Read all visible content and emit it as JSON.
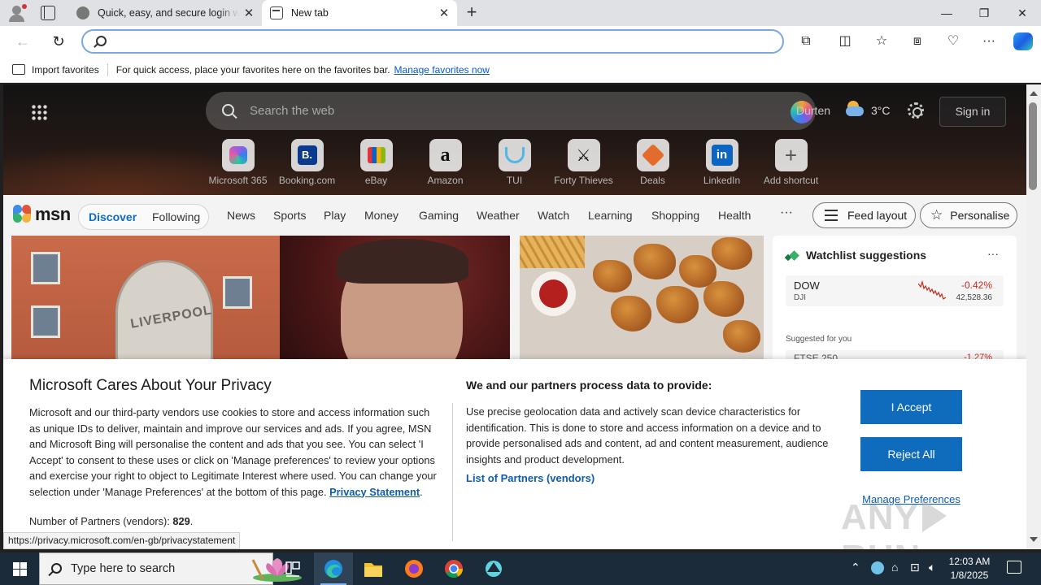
{
  "browser": {
    "tabs": [
      {
        "title": "Quick, easy, and secure login wit",
        "active": false
      },
      {
        "title": "New tab",
        "active": true
      }
    ],
    "address_placeholder": "",
    "window_controls": {
      "minimize": "—",
      "restore": "❐",
      "close": "✕"
    }
  },
  "favorites_bar": {
    "import_label": "Import favorites",
    "message": "For quick access, place your favorites here on the favorites bar.",
    "manage_link": "Manage favorites now"
  },
  "msn": {
    "search_placeholder": "Search the web",
    "location": "Durten",
    "temperature": "3°C",
    "sign_in": "Sign in",
    "shortcuts": [
      {
        "label": "Microsoft 365",
        "icon": "microsoft-365-icon"
      },
      {
        "label": "Booking.com",
        "icon": "booking-icon",
        "glyph": "B."
      },
      {
        "label": "eBay",
        "icon": "ebay-icon"
      },
      {
        "label": "Amazon",
        "icon": "amazon-icon",
        "glyph": "a"
      },
      {
        "label": "TUI",
        "icon": "tui-icon"
      },
      {
        "label": "Forty Thieves",
        "icon": "forty-thieves-icon",
        "glyph": "⚔"
      },
      {
        "label": "Deals",
        "icon": "deals-icon"
      },
      {
        "label": "LinkedIn",
        "icon": "linkedin-icon",
        "glyph": "in"
      },
      {
        "label": "Add shortcut",
        "icon": "plus-icon",
        "glyph": "+"
      }
    ],
    "logo_text": "msn",
    "feed_toggle": {
      "discover": "Discover",
      "following": "Following"
    },
    "nav": [
      "News",
      "Sports",
      "Play",
      "Money",
      "Gaming",
      "Weather",
      "Watch",
      "Learning",
      "Shopping",
      "Health"
    ],
    "more": "···",
    "feed_layout": "Feed layout",
    "personalise": "Personalise",
    "hero_crest_text": "LIVERPOOL",
    "watchlist": {
      "title": "Watchlist suggestions",
      "more": "···",
      "rows": [
        {
          "symbol": "DOW",
          "exchange": "DJI",
          "change": "-0.42%",
          "price": "42,528.36"
        }
      ],
      "suggested_label": "Suggested for you",
      "suggested": [
        {
          "symbol": "FTSE 250",
          "change": "-1.27%"
        }
      ]
    }
  },
  "privacy": {
    "title": "Microsoft Cares About Your Privacy",
    "body": "Microsoft and our third-party vendors use cookies to store and access information such as unique IDs to deliver, maintain and improve our services and ads. If you agree, MSN and Microsoft Bing will personalise the content and ads that you see. You can select 'I Accept' to consent to these uses or click on 'Manage preferences' to review your options and exercise your right to object to Legitimate Interest where used.  You can change your selection under 'Manage Preferences' at the bottom of this page.",
    "privacy_link": "Privacy Statement",
    "partners_count_label": "Number of Partners (vendors):",
    "partners_count": "829",
    "heading2": "We and our partners process data to provide:",
    "body2": "Use precise geolocation data and actively scan device characteristics for identification. This is done to store and access information on a device and to provide personalised ads and content, ad and content measurement, audience insights and product development.",
    "partners_link": "List of Partners (vendors)",
    "accept": "I Accept",
    "reject": "Reject All",
    "manage": "Manage Preferences"
  },
  "status_url": "https://privacy.microsoft.com/en-gb/privacystatement",
  "watermark": "ANY RUN",
  "taskbar": {
    "search_placeholder": "Type here to search",
    "time": "12:03 AM",
    "date": "1/8/2025"
  },
  "colors": {
    "accent": "#0f6cbd",
    "link": "#0f5cab",
    "taskbar": "#1c2b3a",
    "negative": "#c42b1c"
  }
}
